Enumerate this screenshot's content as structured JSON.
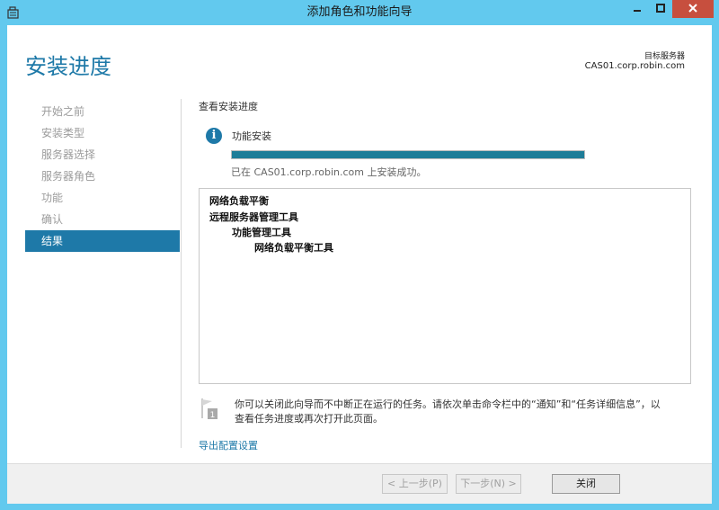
{
  "window": {
    "title": "添加角色和功能向导"
  },
  "header": {
    "page_title": "安装进度",
    "target_label": "目标服务器",
    "target_server": "CAS01.corp.robin.com"
  },
  "nav": {
    "items": [
      {
        "label": "开始之前",
        "active": false
      },
      {
        "label": "安装类型",
        "active": false
      },
      {
        "label": "服务器选择",
        "active": false
      },
      {
        "label": "服务器角色",
        "active": false
      },
      {
        "label": "功能",
        "active": false
      },
      {
        "label": "确认",
        "active": false
      },
      {
        "label": "结果",
        "active": true
      }
    ]
  },
  "content": {
    "section_title": "查看安装进度",
    "install_label": "功能安装",
    "progress": 1.0,
    "status": "已在 CAS01.corp.robin.com 上安装成功。",
    "results": [
      {
        "text": "网络负载平衡",
        "level": 0
      },
      {
        "text": "远程服务器管理工具",
        "level": 0
      },
      {
        "text": "功能管理工具",
        "level": 1
      },
      {
        "text": "网络负载平衡工具",
        "level": 2
      }
    ],
    "note_line1": "你可以关闭此向导而不中断正在运行的任务。请依次单击命令栏中的“通知”和“任务详细信息”，以",
    "note_line2": "查看任务进度或再次打开此页面。",
    "export_link": "导出配置设置"
  },
  "footer": {
    "prev_label": "< 上一步(P)",
    "next_label": "下一步(N) >",
    "close_label": "关闭"
  },
  "colors": {
    "accent": "#1e79a8",
    "titlebar": "#62c9ee",
    "progress": "#1e7d98",
    "close_button": "#c74f3e"
  }
}
